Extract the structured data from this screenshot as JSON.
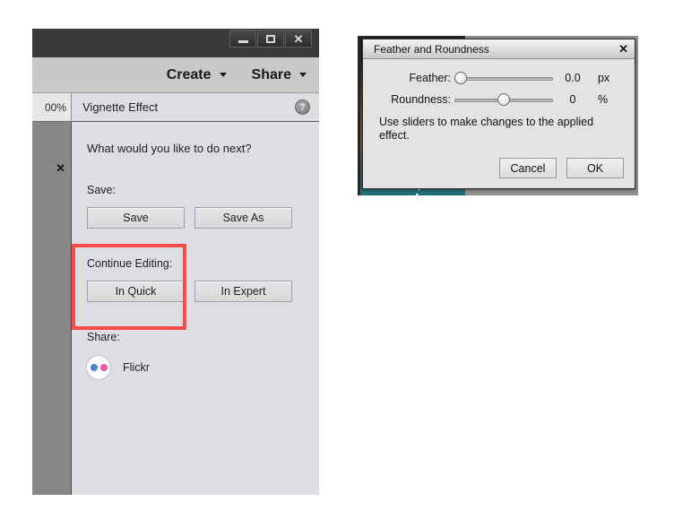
{
  "editor": {
    "window_controls": [
      {
        "name": "minimize",
        "glyph": "—"
      },
      {
        "name": "maximize",
        "glyph": "▢"
      },
      {
        "name": "close",
        "glyph": "✕"
      }
    ],
    "menubar": [
      {
        "label": "Create"
      },
      {
        "label": "Share"
      }
    ],
    "zoom_level": "00%",
    "panel": {
      "title": "Vignette Effect",
      "help_glyph": "?",
      "close_glyph": "✕",
      "prompt": "What would you like to do next?",
      "save_section_label": "Save:",
      "save_button": "Save",
      "save_as_button": "Save As",
      "continue_section_label": "Continue Editing:",
      "in_quick_button": "In Quick",
      "in_expert_button": "In Expert",
      "share_section_label": "Share:",
      "share_service": "Flickr"
    }
  },
  "dialog": {
    "title": "Feather and Roundness",
    "close_glyph": "✕",
    "sliders": [
      {
        "label": "Feather:",
        "value": "0.0",
        "unit": "px",
        "thumb_percent": 0
      },
      {
        "label": "Roundness:",
        "value": "0",
        "unit": "%",
        "thumb_percent": 50
      }
    ],
    "note": "Use sliders to make changes to the applied effect.",
    "cancel_button": "Cancel",
    "ok_button": "OK"
  },
  "annotation": {
    "color": "#fb4b4b"
  }
}
